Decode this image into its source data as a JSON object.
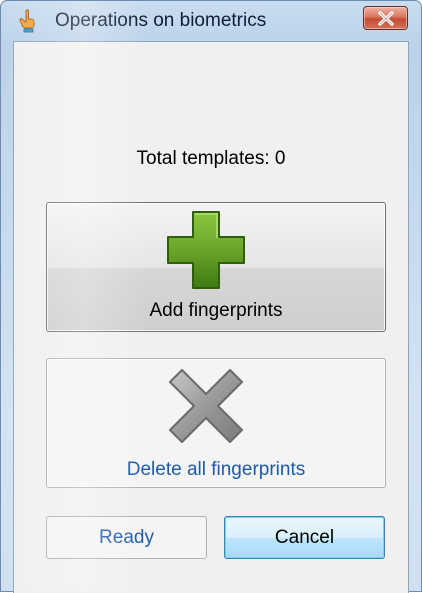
{
  "window": {
    "title": "Operations on biometrics",
    "icon": "hand-pointer-icon"
  },
  "content": {
    "total_templates_label": "Total templates: 0"
  },
  "buttons": {
    "add": {
      "label": "Add fingerprints",
      "icon": "plus-icon",
      "enabled": true,
      "color": "#5f9a1e"
    },
    "delete": {
      "label": "Delete all fingerprints",
      "icon": "x-icon",
      "enabled": false,
      "color": "#8a8a8a"
    },
    "ready": {
      "label": "Ready",
      "enabled": false
    },
    "cancel": {
      "label": "Cancel",
      "enabled": true
    }
  },
  "colors": {
    "frame": "#c7daee",
    "close_button": "#c24d33",
    "disabled_text": "#1e5aa8"
  }
}
